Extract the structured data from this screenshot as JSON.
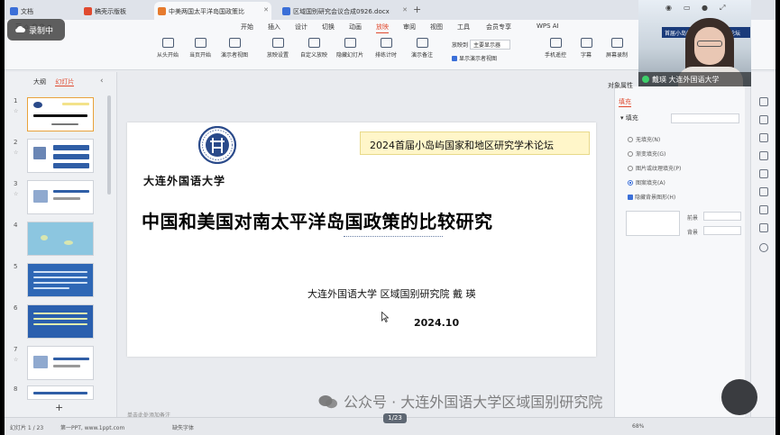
{
  "recording": {
    "label": "录制中"
  },
  "tabs": [
    {
      "label": "文档",
      "color": "#3b6fd8",
      "active": false
    },
    {
      "label": "稿壳示版板",
      "color": "#e04a2f",
      "active": false
    },
    {
      "label": "中美两国太平洋岛国政策比",
      "color": "#e67b2e",
      "active": true
    },
    {
      "label": "区域国别研究会议合成0926.docx",
      "color": "#3b6fd8",
      "active": false
    }
  ],
  "ribbon_tabs": [
    "开始",
    "插入",
    "设计",
    "切换",
    "动画",
    "放映",
    "审阅",
    "视图",
    "工具",
    "会员专享",
    "WPS AI"
  ],
  "ribbon_selected_tab": "放映",
  "ribbon_buttons": [
    "从头开始",
    "当页开始",
    "演示者视图",
    "放映设置",
    "自定义放映",
    "隐藏幻灯片",
    "排练计时",
    "演示备注",
    "手机遥控",
    "字幕",
    "屏幕录制"
  ],
  "ribbon_small": {
    "monitor_label": "放映到",
    "monitor_value": "主要显示器",
    "presenter_view_check": "显示演示者视图"
  },
  "video": {
    "name": "戴瑛 大连外国语大学",
    "banner": "首届小岛屿国家和地区学术论坛"
  },
  "left_panel": {
    "tabs": [
      "大纲",
      "幻灯片"
    ],
    "selected": "幻灯片",
    "slide_numbers": [
      "1",
      "2",
      "3",
      "4",
      "5",
      "6",
      "7",
      "8"
    ],
    "add_button": "+"
  },
  "slide": {
    "university": "大连外国语大学",
    "forum_banner": "2024首届小岛屿国家和地区研究学术论坛",
    "title": "中国和美国对南太平洋岛国政策的比较研究",
    "affiliation": "大连外国语大学  区域国别研究院    戴 瑛",
    "date": "2024.10"
  },
  "notes_placeholder": "单击此处添加备注",
  "right_panel": {
    "header": "对象属性",
    "tab": "填充",
    "section": "填充",
    "options": [
      "无填充(N)",
      "渐变填充(G)",
      "图片或纹理填充(P)",
      "图案填充(A)",
      "隐藏背景图形(H)"
    ],
    "selected_option": "图案填充(A)",
    "checked_option": "隐藏背景图形(H)",
    "fg_label": "前景",
    "bg_label": "背景"
  },
  "status": {
    "slide_info": "幻灯片 1 / 23",
    "theme": "第一PPT, www.1ppt.com",
    "font_warning": "缺失字体",
    "zoom": "68%",
    "page_counter": "1/23"
  },
  "watermark": "公众号 · 大连外国语大学区域国别研究院"
}
